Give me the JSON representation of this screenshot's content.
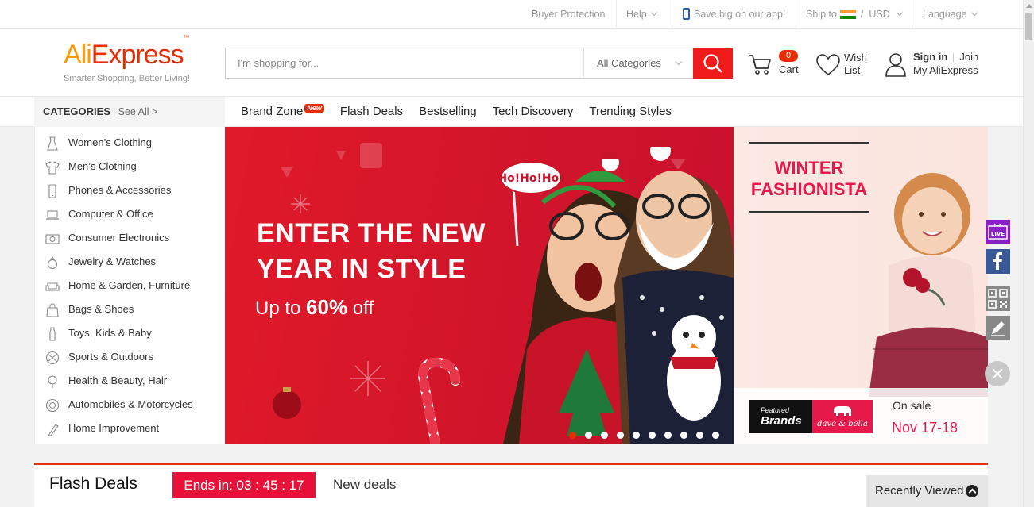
{
  "topbar": {
    "buyer_protection": "Buyer Protection",
    "help": "Help",
    "app": "Save big on our app!",
    "ship_to": "Ship to",
    "currency_sep": "/",
    "currency": "USD",
    "language": "Language"
  },
  "header": {
    "logo_ali": "Ali",
    "logo_express": "Express",
    "logo_tm": "™",
    "tagline": "Smarter Shopping, Better Living!",
    "search_placeholder": "I'm shopping for...",
    "category_select": "All Categories",
    "cart_count": "0",
    "cart_label": "Cart",
    "wish_label": "Wish List",
    "sign_in": "Sign in",
    "join": "Join",
    "my_account": "My AliExpress"
  },
  "nav": {
    "categories_title": "CATEGORIES",
    "see_all": "See All >",
    "links": [
      "Brand Zone",
      "Flash Deals",
      "Bestselling",
      "Tech Discovery",
      "Trending Styles"
    ],
    "new_badge": "New"
  },
  "categories": [
    {
      "label": "Women’s Clothing",
      "icon": "dress-icon"
    },
    {
      "label": "Men’s Clothing",
      "icon": "shirt-icon"
    },
    {
      "label": "Phones & Accessories",
      "icon": "phone-icon"
    },
    {
      "label": "Computer & Office",
      "icon": "laptop-icon"
    },
    {
      "label": "Consumer Electronics",
      "icon": "camera-icon"
    },
    {
      "label": "Jewelry & Watches",
      "icon": "ring-icon"
    },
    {
      "label": "Home & Garden, Furniture",
      "icon": "sofa-icon"
    },
    {
      "label": "Bags & Shoes",
      "icon": "bag-icon"
    },
    {
      "label": "Toys, Kids & Baby",
      "icon": "bottle-icon"
    },
    {
      "label": "Sports & Outdoors",
      "icon": "ball-icon"
    },
    {
      "label": "Health & Beauty, Hair",
      "icon": "bulb-icon"
    },
    {
      "label": "Automobiles & Motorcycles",
      "icon": "wheel-icon"
    },
    {
      "label": "Home Improvement",
      "icon": "tools-icon"
    }
  ],
  "banner": {
    "headline_1": "ENTER THE NEW",
    "headline_2": "YEAR IN STYLE",
    "sub_prefix": "Up to",
    "sub_percent": "60%",
    "sub_suffix": "off",
    "slide_count": 10,
    "active_slide": 0,
    "sign_text": "Ho!Ho!Ho!"
  },
  "promo": {
    "title": "WINTER FASHIONISTA",
    "featured_small": "Featured",
    "featured_big": "Brands",
    "brand": "dave & bella",
    "on_sale": "On sale",
    "date": "Nov 17-18"
  },
  "side_tools": {
    "live": "LIVE"
  },
  "flash": {
    "title": "Flash Deals",
    "ends_label": "Ends in:",
    "countdown": "03 : 45 : 17",
    "new_deals": "New deals",
    "recently_viewed": "Recently Viewed"
  },
  "colors": {
    "brand_red": "#e62e04",
    "logo_orange": "#ff9900",
    "banner_red": "#d5162a",
    "promo_pink": "#e6194b"
  }
}
